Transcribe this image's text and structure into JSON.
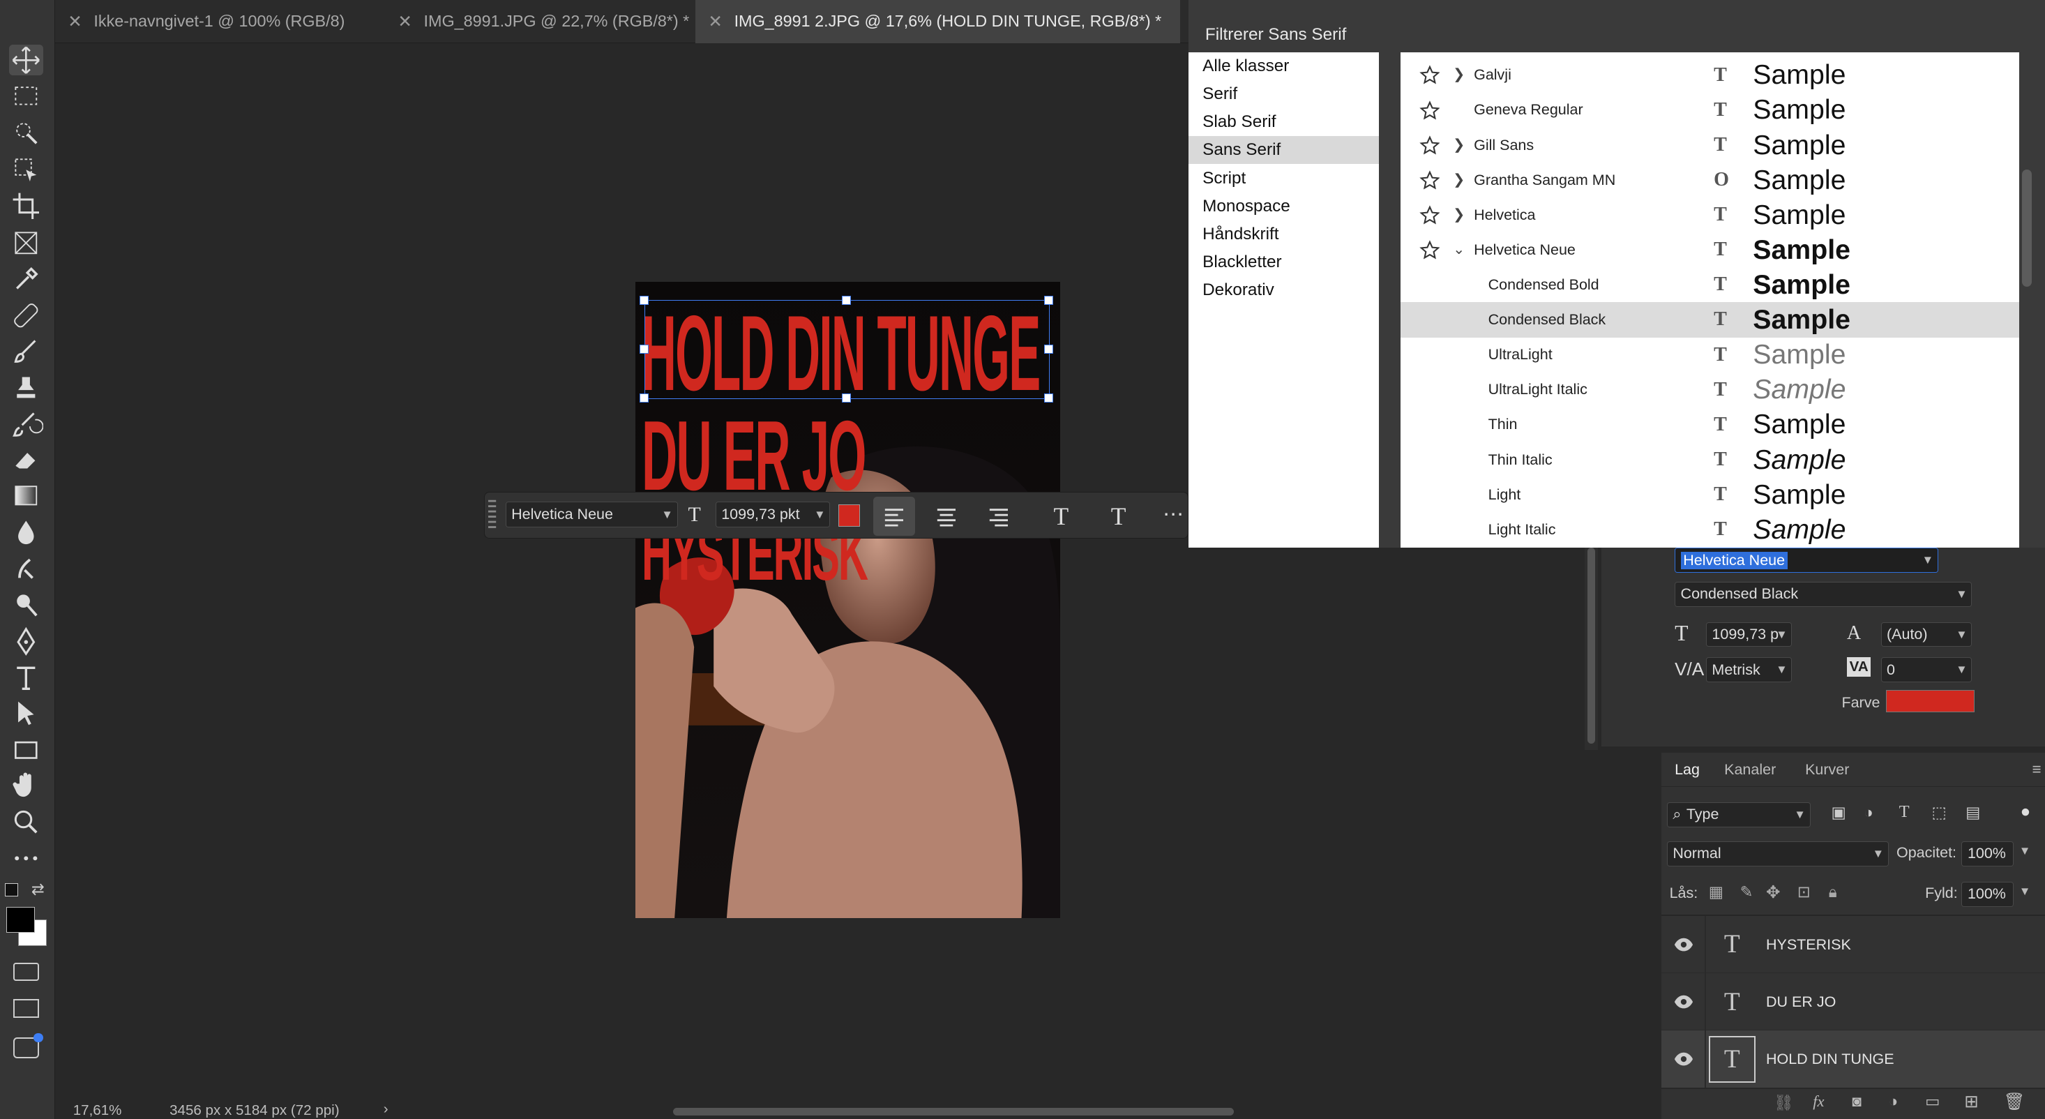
{
  "tabs": [
    {
      "label": "Ikke-navngivet-1 @ 100% (RGB/8)"
    },
    {
      "label": "IMG_8991.JPG @ 22,7% (RGB/8*) *"
    },
    {
      "label": "IMG_8991 2.JPG @ 17,6% (HOLD DIN TUNGE, RGB/8*) *"
    }
  ],
  "tool_icons": [
    "move-icon",
    "marquee-icon",
    "quick-select-icon",
    "object-select-icon",
    "crop-icon",
    "frame-icon",
    "eyedropper-icon",
    "healing-icon",
    "brush-icon",
    "stamp-icon",
    "history-brush-icon",
    "eraser-icon",
    "gradient-icon",
    "blur-icon",
    "smudge-icon",
    "dodge-icon",
    "pen-icon",
    "type-icon",
    "path-select-icon",
    "rectangle-icon",
    "hand-icon",
    "zoom-icon",
    "more-icon"
  ],
  "document": {
    "lines": [
      "HOLD DIN TUNGE",
      "DU ER JO",
      "HYSTERISK"
    ]
  },
  "status": {
    "zoom": "17,61%",
    "size": "3456 px x 5184 px (72 ppi)"
  },
  "context_bar": {
    "font": "Helvetica Neue",
    "size": "1099,73 pkt",
    "color": "#d0281f"
  },
  "font_menu": {
    "title": "Filtrerer Sans Serif",
    "classes": [
      "Alle klasser",
      "Serif",
      "Slab Serif",
      "Sans Serif",
      "Script",
      "Monospace",
      "Håndskrift",
      "Blackletter",
      "Dekorativ"
    ],
    "selected_class": "Sans Serif",
    "sample_text": "Sample",
    "fonts": [
      {
        "name": "Galvji",
        "expand": true,
        "sub": false,
        "icon": "T",
        "style": "normal",
        "weight": "normal"
      },
      {
        "name": "Geneva Regular",
        "expand": false,
        "sub": false,
        "icon": "T",
        "style": "normal",
        "weight": "normal"
      },
      {
        "name": "Gill Sans",
        "expand": true,
        "sub": false,
        "icon": "T",
        "style": "normal",
        "weight": "normal"
      },
      {
        "name": "Grantha Sangam MN",
        "expand": true,
        "sub": false,
        "icon": "O",
        "style": "normal",
        "weight": "normal"
      },
      {
        "name": "Helvetica",
        "expand": true,
        "sub": false,
        "icon": "T",
        "style": "normal",
        "weight": "normal"
      },
      {
        "name": "Helvetica Neue",
        "expand": "open",
        "sub": false,
        "icon": "T",
        "style": "normal",
        "weight": "bold"
      },
      {
        "name": "Condensed Bold",
        "expand": false,
        "sub": true,
        "icon": "T",
        "style": "normal",
        "weight": "bold"
      },
      {
        "name": "Condensed Black",
        "expand": false,
        "sub": true,
        "icon": "T",
        "style": "normal",
        "weight": "bold",
        "selected": true
      },
      {
        "name": "UltraLight",
        "expand": false,
        "sub": true,
        "icon": "T",
        "style": "normal",
        "weight": "lighter"
      },
      {
        "name": "UltraLight Italic",
        "expand": false,
        "sub": true,
        "icon": "T",
        "style": "italic",
        "weight": "lighter"
      },
      {
        "name": "Thin",
        "expand": false,
        "sub": true,
        "icon": "T",
        "style": "normal",
        "weight": "normal"
      },
      {
        "name": "Thin Italic",
        "expand": false,
        "sub": true,
        "icon": "T",
        "style": "italic",
        "weight": "normal"
      },
      {
        "name": "Light",
        "expand": false,
        "sub": true,
        "icon": "T",
        "style": "normal",
        "weight": "normal"
      },
      {
        "name": "Light Italic",
        "expand": false,
        "sub": true,
        "icon": "T",
        "style": "italic",
        "weight": "normal"
      }
    ]
  },
  "character": {
    "font_family": "Helvetica Neue",
    "font_style": "Condensed Black",
    "size": "1099,73 p",
    "leading": "(Auto)",
    "kerning": "Metrisk",
    "tracking": "0",
    "color_label": "Farve",
    "color": "#d0281f"
  },
  "layers_panel": {
    "tabs": [
      "Lag",
      "Kanaler",
      "Kurver"
    ],
    "filter": "Type",
    "blend_mode": "Normal",
    "opacity_label": "Opacitet:",
    "opacity": "100%",
    "lock_label": "Lås:",
    "fill_label": "Fyld:",
    "fill": "100%",
    "layers": [
      {
        "name": "HYSTERISK"
      },
      {
        "name": "DU ER JO"
      },
      {
        "name": "HOLD DIN TUNGE"
      }
    ]
  }
}
